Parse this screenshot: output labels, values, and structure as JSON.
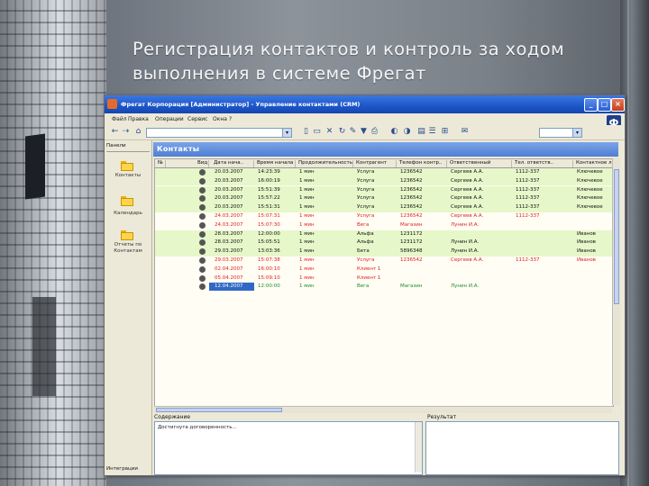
{
  "slide": {
    "title_line1": "Регистрация контактов и контроль за ходом",
    "title_line2": "выполнения в системе Фрегат"
  },
  "window": {
    "title": "Фрегат Корпорация [Администратор] - Управление контактами (CRM)",
    "controls": {
      "minimize": "_",
      "maximize": "□",
      "close": "×"
    },
    "logo_text": "Ф"
  },
  "menu": [
    "Файл",
    "Правка",
    "Операции",
    "Сервис",
    "Окна",
    "?"
  ],
  "toolbar": {
    "icons": [
      "back-icon",
      "forward-icon",
      "home-icon",
      "new-doc-icon",
      "doc-icon",
      "delete-icon",
      "refresh-icon",
      "tools-icon",
      "filter-icon",
      "print-icon",
      "prev-icon",
      "next-icon",
      "attach-icon",
      "list-icon",
      "clip-icon",
      "settings-icon"
    ]
  },
  "left_panel": {
    "header": "Панели",
    "folders": [
      "Контакты",
      "Календарь",
      "Отчеты по Контактам"
    ],
    "footer": "Интеграции"
  },
  "content": {
    "title": "Контакты"
  },
  "grid": {
    "columns": [
      "№",
      "Вид",
      "Дата нача..",
      "Время начала",
      "Продолжительность",
      "Контрагент",
      "Телефон контр..",
      "Ответственный",
      "Тел. ответств..",
      "Контактное лицо"
    ],
    "rows": [
      {
        "style": "green",
        "date": "20.03.2007",
        "time": "14:23:39",
        "dur": "1 мин",
        "org": "Услуга",
        "tel": "1236542",
        "resp": "Сергеев А.А.",
        "rtel": "1112-337",
        "contact": "Ключевое"
      },
      {
        "style": "green",
        "date": "20.03.2007",
        "time": "16:00:19",
        "dur": "1 мин",
        "org": "Услуга",
        "tel": "1236542",
        "resp": "Сергеев А.А.",
        "rtel": "1112-337",
        "contact": "Ключевое"
      },
      {
        "style": "green",
        "date": "20.03.2007",
        "time": "15:51:39",
        "dur": "1 мин",
        "org": "Услуга",
        "tel": "1236542",
        "resp": "Сергеев А.А.",
        "rtel": "1112-337",
        "contact": "Ключевое"
      },
      {
        "style": "green",
        "date": "20.03.2007",
        "time": "15:57:22",
        "dur": "1 мин",
        "org": "Услуга",
        "tel": "1236542",
        "resp": "Сергеев А.А.",
        "rtel": "1112-337",
        "contact": "Ключевое"
      },
      {
        "style": "green",
        "date": "20.03.2007",
        "time": "15:51:31",
        "dur": "1 мин",
        "org": "Услуга",
        "tel": "1236542",
        "resp": "Сергеев А.А.",
        "rtel": "1112-337",
        "contact": "Ключевое"
      },
      {
        "style": "white red",
        "date": "24.03.2007",
        "time": "15:07:31",
        "dur": "1 мин",
        "org": "Услуга",
        "tel": "1236542",
        "resp": "Сергеев А.А.",
        "rtel": "1112-337",
        "contact": ""
      },
      {
        "style": "white red",
        "date": "24.03.2007",
        "time": "15:07:30",
        "dur": "1 мин",
        "org": "Вега",
        "tel": "Магазин",
        "resp": "Лунин И.А.",
        "rtel": "",
        "contact": ""
      },
      {
        "style": "green",
        "date": "28.03.2007",
        "time": "12:00:00",
        "dur": "1 мин",
        "org": "Альфа",
        "tel": "1231172",
        "resp": "",
        "rtel": "",
        "contact": "Иванов"
      },
      {
        "style": "green",
        "date": "28.03.2007",
        "time": "15:05:51",
        "dur": "1 мин",
        "org": "Альфа",
        "tel": "1231172",
        "resp": "Лунин И.А.",
        "rtel": "",
        "contact": "Иванов"
      },
      {
        "style": "green",
        "date": "29.03.2007",
        "time": "13:03:36",
        "dur": "1 мин",
        "org": "Бета",
        "tel": "5896348",
        "resp": "Лунин И.А.",
        "rtel": "",
        "contact": "Иванов"
      },
      {
        "style": "white red",
        "date": "29.03.2007",
        "time": "15:07:38",
        "dur": "1 мин",
        "org": "Услуга",
        "tel": "1236542",
        "resp": "Сергеев А.А.",
        "rtel": "1112-337",
        "contact": "Иванов"
      },
      {
        "style": "white red",
        "date": "02.04.2007",
        "time": "16:00:10",
        "dur": "1 мин",
        "org": "Клиент 1",
        "tel": "",
        "resp": "",
        "rtel": "",
        "contact": ""
      },
      {
        "style": "white red",
        "date": "05.04.2007",
        "time": "15:09:10",
        "dur": "1 мин",
        "org": "Клиент 1",
        "tel": "",
        "resp": "",
        "rtel": "",
        "contact": ""
      },
      {
        "style": "white green-text selected",
        "date": "12.04.2007",
        "time": "12:00:00",
        "dur": "1 мин",
        "org": "Вега",
        "tel": "Магазин",
        "resp": "Лунин И.А.",
        "rtel": "",
        "contact": ""
      }
    ]
  },
  "bottom": {
    "content_label": "Содержание",
    "content_text": "Достигнута договоренность...",
    "result_label": "Результат"
  }
}
